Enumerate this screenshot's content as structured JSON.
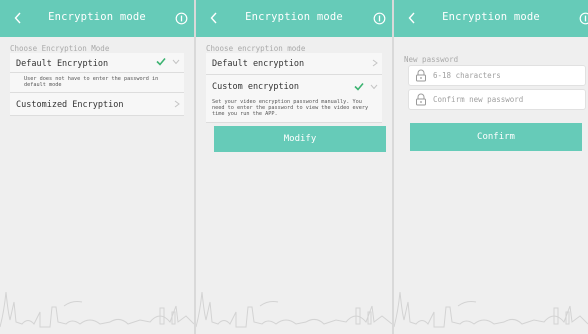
{
  "colors": {
    "accent": "#66cbb8",
    "check_green": "#3cb371",
    "background": "#efefef"
  },
  "icons": {
    "back": "chevron-left-icon",
    "info": "info-icon",
    "check": "check-icon",
    "chevron": "chevron-right-icon",
    "lock": "lock-icon",
    "skyline": "city-skyline-decoration"
  },
  "screen1": {
    "title": "Encryption mode",
    "section_label": "Choose Encryption Mode",
    "options": [
      {
        "label": "Default Encryption",
        "selected": true,
        "desc": "User does not have to enter the password in default mode"
      },
      {
        "label": "Customized Encryption",
        "selected": false
      }
    ]
  },
  "screen2": {
    "title": "Encryption mode",
    "section_label": "Choose encryption mode",
    "options": [
      {
        "label": "Default encryption",
        "selected": false
      },
      {
        "label": "Custom encryption",
        "selected": true,
        "desc": "Set your video encryption password manually. You need to enter the password to view the video every time you run the APP."
      }
    ],
    "modify_label": "Modify"
  },
  "screen3": {
    "title": "Encryption mode",
    "section_label": "New password",
    "password_placeholder": "6-18 characters",
    "confirm_placeholder": "Confirm new password",
    "confirm_label": "Confirm"
  }
}
